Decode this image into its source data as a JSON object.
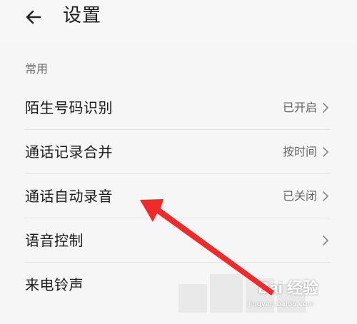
{
  "header": {
    "back_icon": "arrow-left-icon",
    "title": "设置"
  },
  "section": {
    "label": "常用"
  },
  "rows": [
    {
      "label": "陌生号码识别",
      "value": "已开启",
      "chevron": "chevron-right-icon"
    },
    {
      "label": "通话记录合并",
      "value": "按时间",
      "chevron": "chevron-right-icon"
    },
    {
      "label": "通话自动录音",
      "value": "已关闭",
      "chevron": "chevron-right-icon"
    },
    {
      "label": "语音控制",
      "value": "",
      "chevron": "chevron-right-icon"
    },
    {
      "label": "来电铃声",
      "value": ""
    }
  ],
  "annotation": {
    "arrow_color": "#ee2a2a"
  },
  "watermark": {
    "text": "Bai 经验",
    "subtext": "jingyan.baidu.com"
  }
}
